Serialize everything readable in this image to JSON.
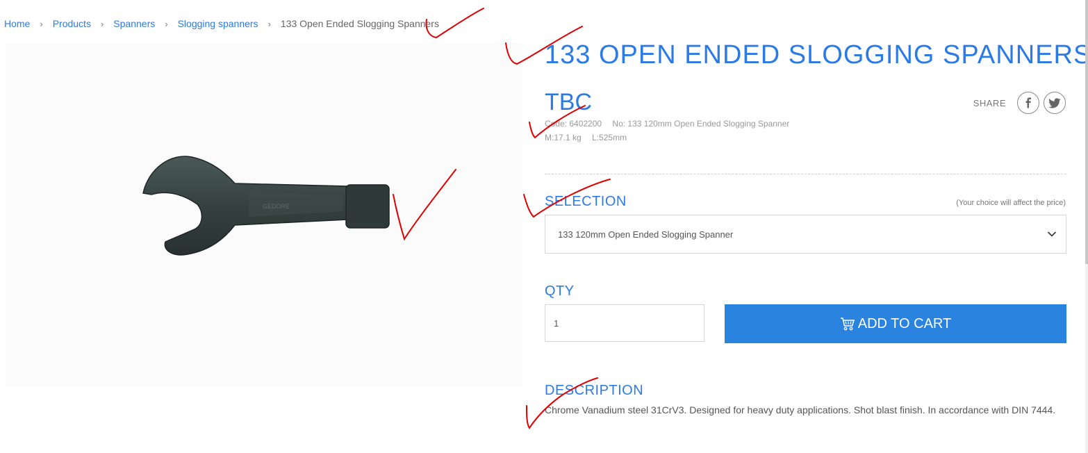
{
  "breadcrumb": {
    "items": [
      "Home",
      "Products",
      "Spanners",
      "Slogging spanners"
    ],
    "current": "133 Open Ended Slogging Spanners"
  },
  "product": {
    "title": "133 OPEN ENDED SLOGGING SPANNERS",
    "price": "TBC",
    "code_text": "Code: 6402200",
    "no_text": "No: 133 120mm Open Ended Slogging Spanner",
    "mass_text": "M:17.1 kg",
    "length_text": "L:525mm",
    "image_icon": "slogging-spanner-photo"
  },
  "share": {
    "label": "SHARE",
    "icons": [
      "facebook-icon",
      "twitter-icon"
    ]
  },
  "selection": {
    "label": "SELECTION",
    "note": "(Your choice will affect the price)",
    "selected": "133 120mm Open Ended Slogging Spanner"
  },
  "qty": {
    "label": "QTY",
    "value": "1"
  },
  "cart": {
    "label": "ADD TO CART",
    "icon": "cart-icon",
    "color": "#2b83e0"
  },
  "description": {
    "label": "DESCRIPTION",
    "text": "Chrome Vanadium steel 31CrV3. Designed for heavy duty applications. Shot blast finish. In accordance with DIN 7444."
  },
  "colors": {
    "accent": "#2c7be5",
    "annotation": "#e00000"
  }
}
